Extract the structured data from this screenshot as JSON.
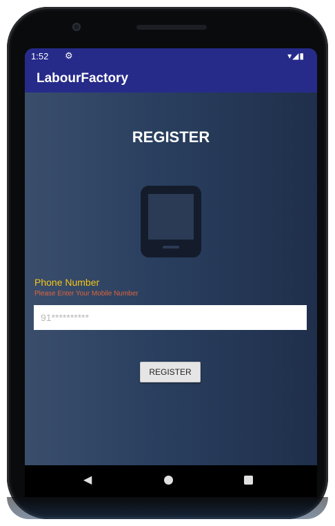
{
  "status_bar": {
    "time": "1:52",
    "settings_icon": "gear-icon",
    "indicators": "▾◢▮"
  },
  "app_bar": {
    "title": "LabourFactory"
  },
  "main": {
    "heading": "REGISTER",
    "illustration_icon": "smartphone-icon",
    "phone_label": "Phone Number",
    "phone_hint": "Please Enter Your Mobile Number",
    "phone_input": {
      "value": "",
      "placeholder": "91**********"
    },
    "register_button": "REGISTER"
  },
  "nav_bar": {
    "back": "◀",
    "home": "home-icon",
    "recents": "recents-icon"
  },
  "colors": {
    "app_bar": "#262b8a",
    "label": "#f5c518",
    "hint": "#e0643c",
    "background": "#2a3f5f"
  }
}
